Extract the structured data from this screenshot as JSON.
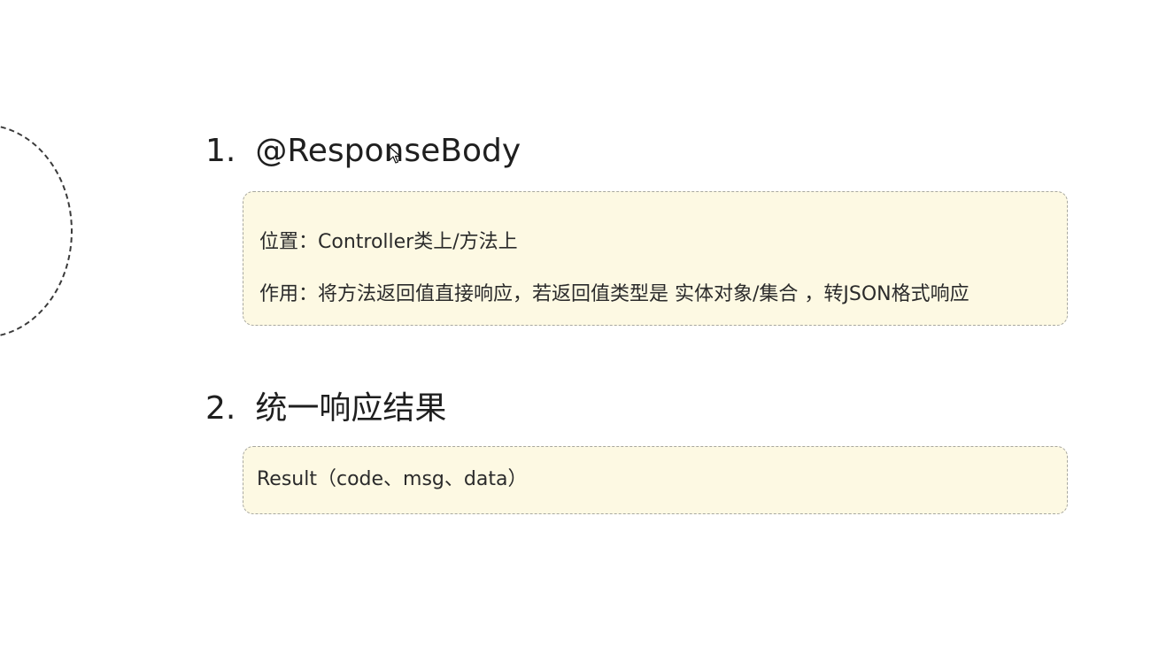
{
  "section1": {
    "number": "1.",
    "title": "@ResponseBody",
    "lines": [
      "位置：Controller类上/方法上",
      "作用：将方法返回值直接响应，若返回值类型是 实体对象/集合 ，转JSON格式响应"
    ]
  },
  "section2": {
    "number": "2.",
    "title": "统一响应结果",
    "lines": [
      "Result（code、msg、data）"
    ]
  },
  "colors": {
    "background": "#ffffff",
    "note_box_fill": "#fdf9e3",
    "note_box_border": "#a8a8a0",
    "text": "#222222"
  }
}
